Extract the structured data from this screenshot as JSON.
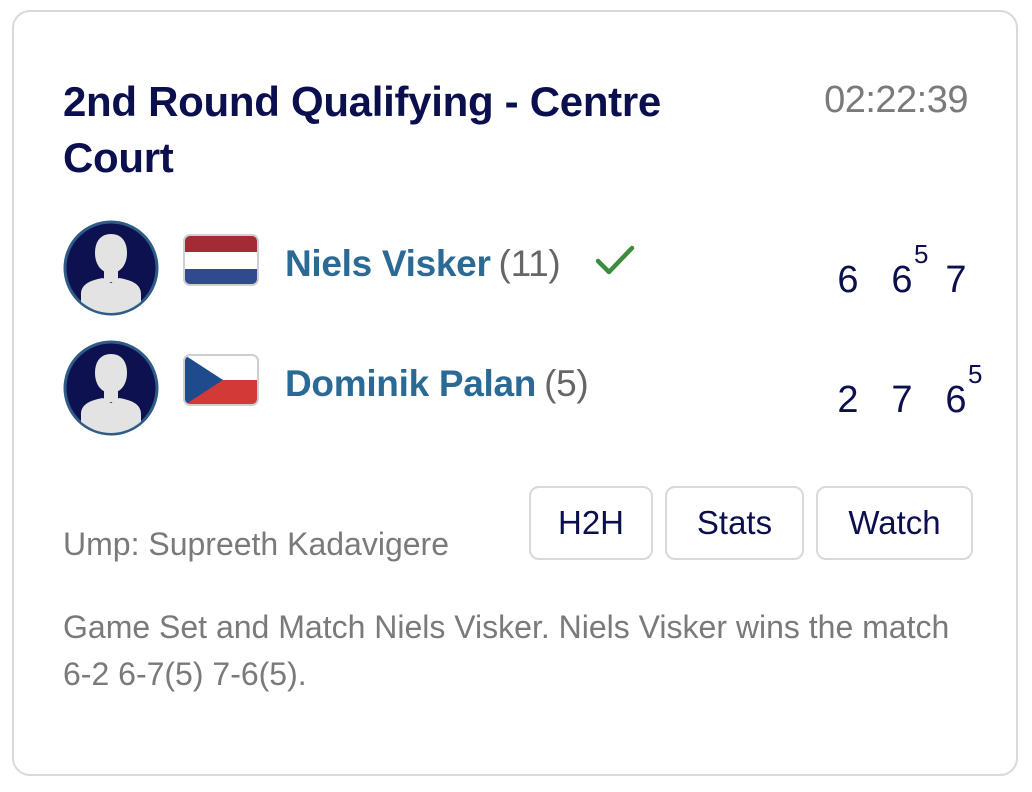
{
  "match": {
    "title": "2nd Round Qualifying - Centre Court",
    "time": "02:22:39",
    "players": [
      {
        "name": "Niels Visker",
        "seed": "(11)",
        "country_flag": "netherlands-flag",
        "winner": true,
        "sets": [
          "6",
          "6",
          "7"
        ],
        "tiebreaks": [
          "",
          "5",
          ""
        ]
      },
      {
        "name": "Dominik Palan",
        "seed": "(5)",
        "country_flag": "czech-republic-flag",
        "winner": false,
        "sets": [
          "2",
          "7",
          "6"
        ],
        "tiebreaks": [
          "",
          "",
          "5"
        ]
      }
    ],
    "umpire": "Ump: Supreeth Kadavigere",
    "buttons": {
      "h2h": "H2H",
      "stats": "Stats",
      "watch": "Watch"
    },
    "summary": "Game Set and Match Niels Visker. Niels Visker wins the match 6-2 6-7(5) 7-6(5)."
  },
  "colors": {
    "title": "#0b0f4d",
    "player_name": "#2a6a95",
    "muted": "#7a7a7a",
    "winner_check": "#3e8c3e",
    "border": "#d9d9d9"
  },
  "icons": {
    "avatar": "avatar-silhouette-icon",
    "winner": "check-icon"
  }
}
